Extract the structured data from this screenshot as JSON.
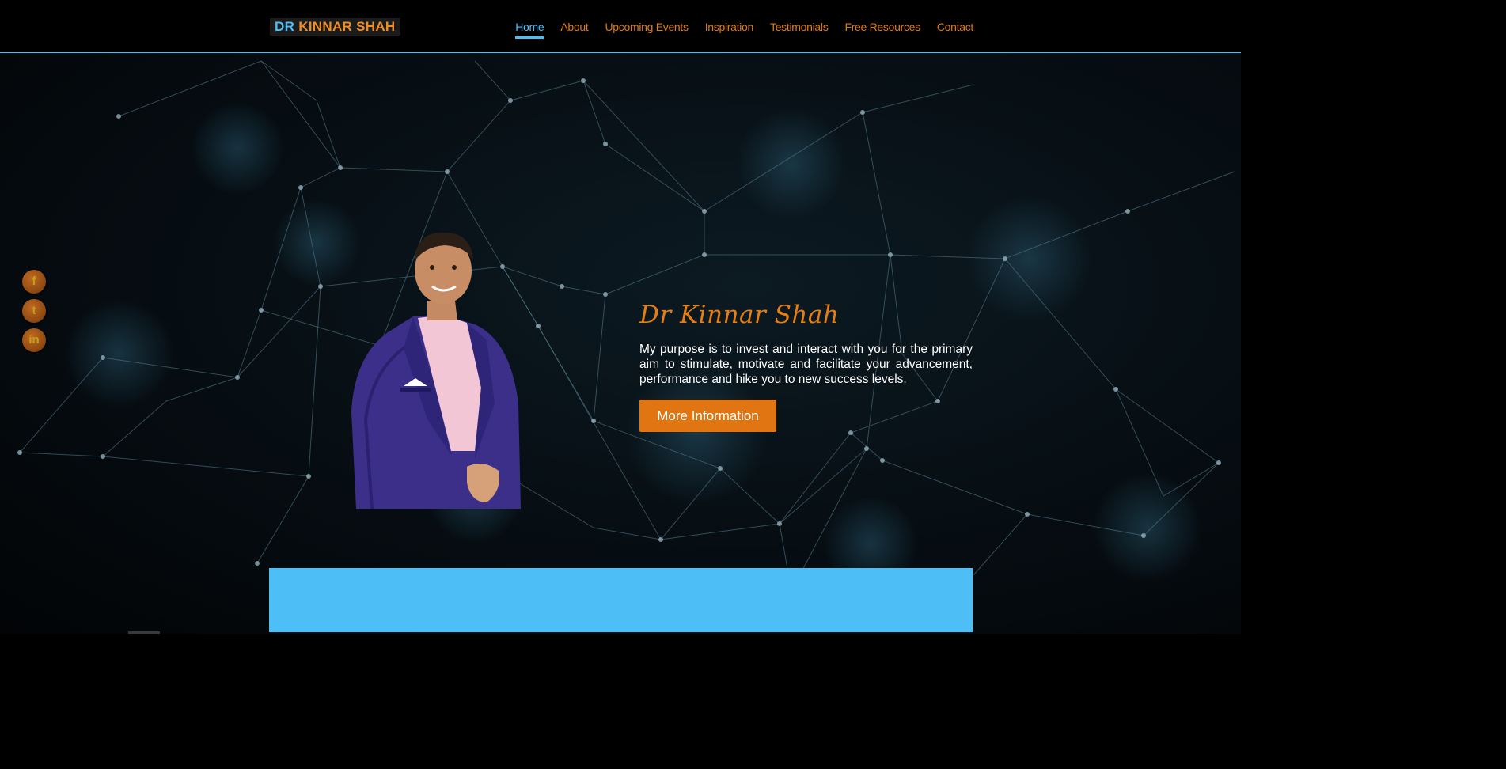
{
  "header": {
    "logo_prefix": "DR",
    "logo_name": "KINNAR SHAH",
    "nav": [
      {
        "label": "Home",
        "active": true
      },
      {
        "label": "About"
      },
      {
        "label": "Upcoming Events"
      },
      {
        "label": "Inspiration"
      },
      {
        "label": "Testimonials"
      },
      {
        "label": "Free Resources"
      },
      {
        "label": "Contact"
      }
    ]
  },
  "social": {
    "facebook": "f",
    "twitter": "t",
    "linkedin": "in"
  },
  "hero": {
    "title": "Dr Kinnar Shah",
    "description": "My purpose is to invest and interact with you for the primary aim to stimulate, motivate and facilitate your advancement, performance and hike you to new success levels.",
    "cta_label": "More Information"
  },
  "colors": {
    "accent_blue": "#4ebef7",
    "accent_orange": "#e07512",
    "background": "#000000"
  },
  "icons": [
    "facebook-icon",
    "twitter-icon",
    "linkedin-icon"
  ]
}
